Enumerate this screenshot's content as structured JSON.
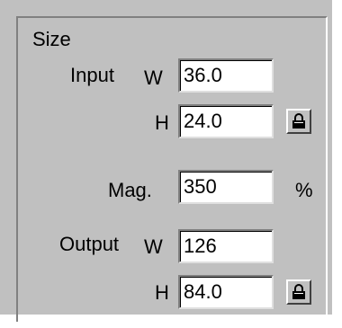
{
  "group": {
    "title": "Size"
  },
  "input": {
    "label": "Input",
    "w_label": "W",
    "w_value": "36.0",
    "h_label": "H",
    "h_value": "24.0"
  },
  "mag": {
    "label": "Mag.",
    "value": "350",
    "unit": "%"
  },
  "output": {
    "label": "Output",
    "w_label": "W",
    "w_value": "126",
    "h_label": "H",
    "h_value": "84.0"
  },
  "icons": {
    "input_lock": "lock-icon",
    "output_lock": "lock-icon"
  }
}
